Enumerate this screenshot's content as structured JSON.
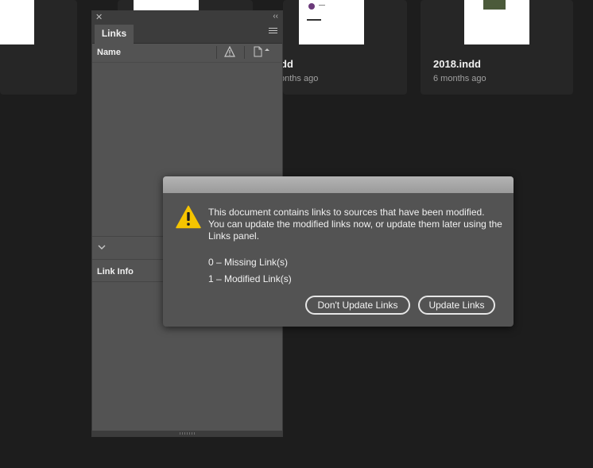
{
  "colors": {
    "background": "#1d1d1d",
    "panel": "#535353",
    "dialog_titlebar": "#a8a8a8",
    "warning": "#f5c400"
  },
  "documents": [
    {
      "title": "",
      "subtitle": ""
    },
    {
      "title": "",
      "subtitle": ""
    },
    {
      "title": "dd",
      "subtitle": "onths ago"
    },
    {
      "title": "2018.indd",
      "subtitle": "6 months ago"
    }
  ],
  "links_panel": {
    "tab_label": "Links",
    "name_column": "Name",
    "link_info_label": "Link Info",
    "icons": {
      "close": "close-icon",
      "collapse": "collapse-icon",
      "menu": "panel-menu-icon",
      "status": "warning-icon",
      "page": "page-icon",
      "expand": "chevron-down-icon"
    }
  },
  "dialog": {
    "message": "This document contains links to sources that have been modified. You can update the modified links now, or update them later using the Links panel.",
    "missing_links": "0 – Missing Link(s)",
    "modified_links": "1 – Modified Link(s)",
    "dont_update_label": "Don't Update Links",
    "update_label": "Update Links",
    "icon": "warning-icon"
  }
}
